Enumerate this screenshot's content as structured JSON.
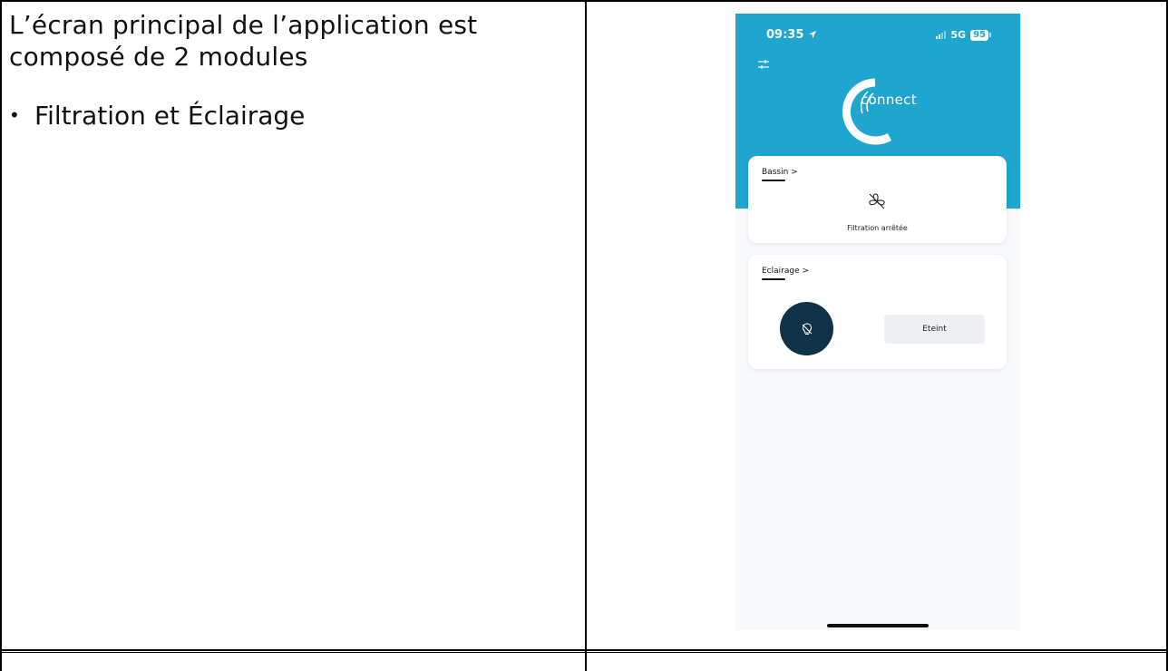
{
  "document": {
    "heading_line1": "L’écran principal de l’application est",
    "heading_line2": "composé de 2 modules",
    "bullet_symbol": "•",
    "bullet_text": "Filtration et Éclairage"
  },
  "phone": {
    "status": {
      "time": "09:35",
      "network": "5G",
      "battery": "95"
    },
    "logo_text": "connect",
    "cards": {
      "bassin": {
        "title": "Bassin >",
        "status": "Filtration arrêtée",
        "icon": "fan-off-icon"
      },
      "eclairage": {
        "title": "Eclairage >",
        "state_label": "Eteint",
        "icon": "bulb-off-icon"
      }
    }
  },
  "colors": {
    "header_blue": "#1ea6d0",
    "dark_navy": "#0f3249",
    "card_bg": "#ffffff"
  }
}
